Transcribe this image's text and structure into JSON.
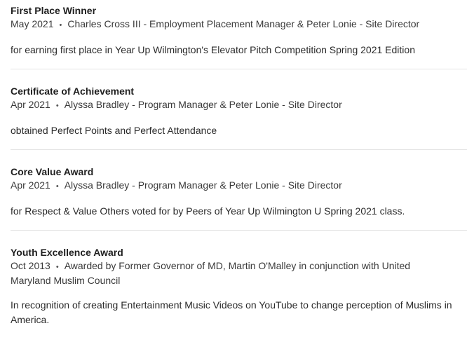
{
  "awards": [
    {
      "title": "First Place Winner",
      "date": "May 2021",
      "issuer": "Charles Cross III - Employment Placement Manager & Peter Lonie - Site Director",
      "description": "for earning first place in Year Up Wilmington's Elevator Pitch Competition Spring 2021 Edition"
    },
    {
      "title": "Certificate of Achievement",
      "date": "Apr 2021",
      "issuer": "Alyssa Bradley - Program Manager & Peter Lonie - Site Director",
      "description": "obtained Perfect Points and Perfect Attendance"
    },
    {
      "title": "Core Value Award",
      "date": "Apr 2021",
      "issuer": "Alyssa Bradley - Program Manager & Peter Lonie - Site Director",
      "description": "for Respect & Value Others voted for by Peers of Year Up Wilmington U Spring 2021 class."
    },
    {
      "title": "Youth Excellence Award",
      "date": "Oct 2013",
      "issuer": "Awarded by Former Governor of MD, Martin O'Malley in conjunction with United Maryland Muslim Council",
      "description": "In recognition of creating Entertainment Music Videos on YouTube to change perception of Muslims in America."
    }
  ],
  "separator": "•"
}
